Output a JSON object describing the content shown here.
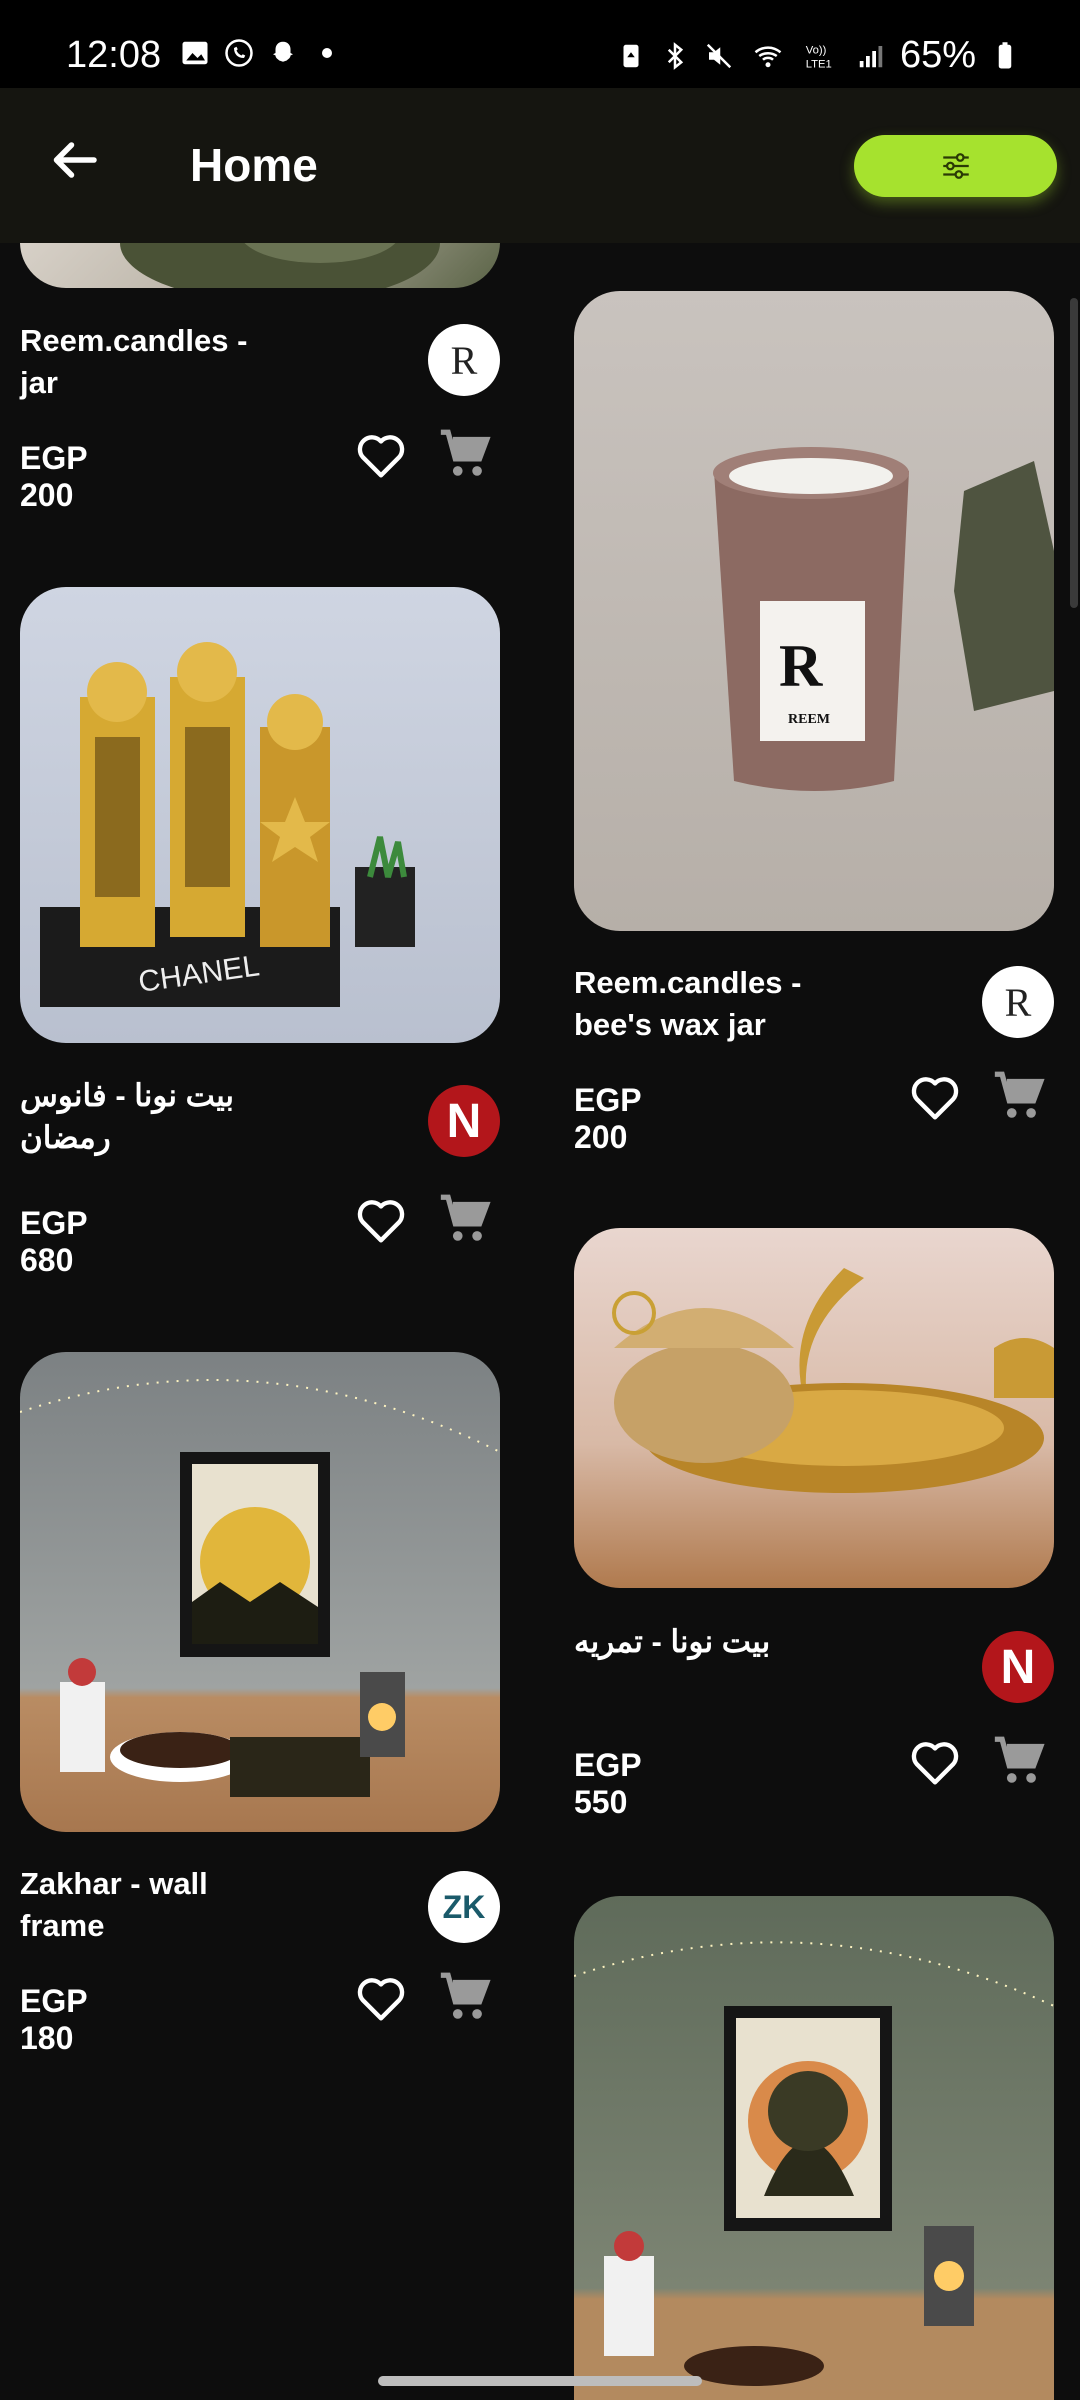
{
  "status": {
    "time": "12:08",
    "battery": "65%",
    "icons": [
      "gallery-icon",
      "whatsapp-icon",
      "snapchat-icon",
      "dot-icon",
      "battery-saver-icon",
      "bluetooth-icon",
      "mute-icon",
      "wifi-icon",
      "lte-icon",
      "signal-icon",
      "battery-icon"
    ]
  },
  "header": {
    "title": "Home",
    "back_icon": "arrow-left-icon",
    "filter_icon": "sliders-icon",
    "accent": "#a6e22e"
  },
  "products_left": [
    {
      "name": "Reem.candles - jar",
      "price": "EGP 200",
      "vendor_initial": "R"
    },
    {
      "name": "بيت نونا - فانوس رمضان",
      "price": "EGP 680",
      "vendor_initial": "N"
    },
    {
      "name": "Zakhar - wall frame",
      "price": "EGP 180",
      "vendor_initial": "ZK"
    }
  ],
  "products_right": [
    {
      "name": "Reem.candles - bee's wax jar",
      "price": "EGP 200",
      "vendor_initial": "R"
    },
    {
      "name": "بيت نونا - تمريه",
      "price": "EGP 550",
      "vendor_initial": "N"
    }
  ],
  "image_labels": {
    "candle_brand": "REEM",
    "book_brand": "CHANEL"
  }
}
